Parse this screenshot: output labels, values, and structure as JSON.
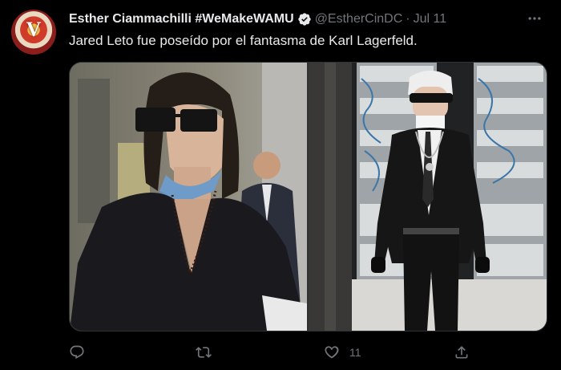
{
  "tweet": {
    "display_name": "Esther Ciammachilli #WeMakeWAMU",
    "handle": "@EstherCinDC",
    "separator": "·",
    "date": "Jul 11",
    "text": "Jared Leto fue poseído por el fantasma de Karl Lagerfeld.",
    "avatar_letter": "V",
    "verified_icon": "verified-badge-icon"
  },
  "actions": {
    "reply_icon": "reply-icon",
    "retweet_icon": "retweet-icon",
    "like_icon": "heart-icon",
    "like_count": "11",
    "share_icon": "share-icon"
  },
  "colors": {
    "background": "#000000",
    "primary_text": "#e7e9ea",
    "secondary_text": "#71767b",
    "border": "#2f3336"
  }
}
